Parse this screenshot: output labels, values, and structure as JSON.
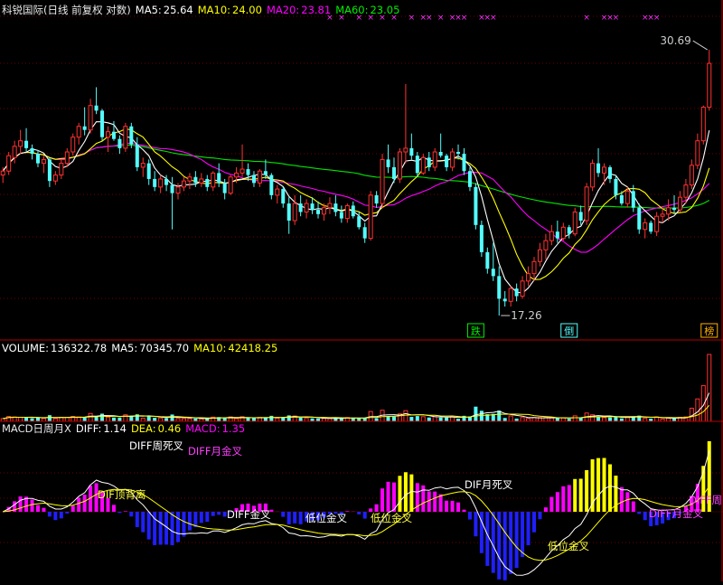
{
  "colors": {
    "up": "#ff3232",
    "down": "#54fcfc",
    "ma5": "#ffffff",
    "ma10": "#ffff00",
    "ma20": "#ff00ff",
    "ma60": "#00e600",
    "grid": "#6e0000",
    "panel_border": "#b40000",
    "macd_pos_top": "#ffff00",
    "macd_pos_mid": "#ff00ff",
    "macd_neg": "#2020ff"
  },
  "price_panel": {
    "title": "科锐国际(日线 前复权 对数)",
    "ma5": {
      "label": "MA5:",
      "value": "25.64"
    },
    "ma10": {
      "label": "MA10:",
      "value": "24.00"
    },
    "ma20": {
      "label": "MA20:",
      "value": "23.81"
    },
    "ma60": {
      "label": "MA60:",
      "value": "23.05"
    },
    "high_marker": "30.69",
    "low_marker": "17.26",
    "tags": [
      "跌",
      "倒",
      "榜"
    ]
  },
  "volume_panel": {
    "title": "VOLUME:",
    "volume": "136322.78",
    "ma5_label": "MA5:",
    "ma5": "70345.70",
    "ma10_label": "MA10:",
    "ma10": "42418.25"
  },
  "macd_panel": {
    "title": "MACD日周月X",
    "diff_label": "DIFF:",
    "diff": "1.14",
    "dea_label": "DEA:",
    "dea": "0.46",
    "macd_label": "MACD:",
    "macd": "1.35",
    "annotations": [
      {
        "text": "DIFF周死叉",
        "color": "#ffffff"
      },
      {
        "text": "DIFF月金叉",
        "color": "#ff40ff"
      },
      {
        "text": "DIF顶背离",
        "color": "#ffff40"
      },
      {
        "text": "DIFF金叉",
        "color": "#ffffff"
      },
      {
        "text": "低位金叉",
        "color": "#ffffff"
      },
      {
        "text": "低位金叉",
        "color": "#ffff40"
      },
      {
        "text": "DIF月死叉",
        "color": "#ffffff"
      },
      {
        "text": "低位金叉",
        "color": "#ffff40"
      },
      {
        "text": "DIFF月金叉",
        "color": "#ff40ff"
      },
      {
        "text": "DIFF周",
        "color": "#ff40ff"
      }
    ]
  },
  "chart_data": [
    {
      "type": "candlestick",
      "title": "科锐国际(日线 前复权 对数)",
      "yscale": "log",
      "ylim": [
        16.5,
        33
      ],
      "candles": [
        [
          23.4,
          23.8,
          23.0,
          23.6
        ],
        [
          23.6,
          24.6,
          23.4,
          24.4
        ],
        [
          24.3,
          25.2,
          24.0,
          24.9
        ],
        [
          24.9,
          25.8,
          24.5,
          25.2
        ],
        [
          25.2,
          25.9,
          24.6,
          24.8
        ],
        [
          24.8,
          25.0,
          24.2,
          24.5
        ],
        [
          24.5,
          24.7,
          23.8,
          24.0
        ],
        [
          24.0,
          24.4,
          23.5,
          24.2
        ],
        [
          24.2,
          24.3,
          22.8,
          23.1
        ],
        [
          23.1,
          23.6,
          22.9,
          23.4
        ],
        [
          23.4,
          24.2,
          23.2,
          24.0
        ],
        [
          24.0,
          24.8,
          23.8,
          24.6
        ],
        [
          24.6,
          25.6,
          24.4,
          25.4
        ],
        [
          25.4,
          26.2,
          25.0,
          26.0
        ],
        [
          26.0,
          27.1,
          25.5,
          25.8
        ],
        [
          25.8,
          27.6,
          25.6,
          27.2
        ],
        [
          27.2,
          28.3,
          26.7,
          26.9
        ],
        [
          26.9,
          27.0,
          25.2,
          25.4
        ],
        [
          25.4,
          26.0,
          24.6,
          25.7
        ],
        [
          25.7,
          26.3,
          25.2,
          25.3
        ],
        [
          25.3,
          25.5,
          24.5,
          24.8
        ],
        [
          24.8,
          26.2,
          24.6,
          26.0
        ],
        [
          26.0,
          26.2,
          24.8,
          25.0
        ],
        [
          25.0,
          25.4,
          23.6,
          23.8
        ],
        [
          23.8,
          24.3,
          23.3,
          24.0
        ],
        [
          24.0,
          24.2,
          22.9,
          23.2
        ],
        [
          23.2,
          23.6,
          22.6,
          22.8
        ],
        [
          22.8,
          23.4,
          22.5,
          23.2
        ],
        [
          23.2,
          23.4,
          22.6,
          22.9
        ],
        [
          22.9,
          23.3,
          20.8,
          22.5
        ],
        [
          22.5,
          23.0,
          22.2,
          22.8
        ],
        [
          22.8,
          23.3,
          22.6,
          23.1
        ],
        [
          23.1,
          23.5,
          22.7,
          23.3
        ],
        [
          23.3,
          23.6,
          22.8,
          23.0
        ],
        [
          23.0,
          23.5,
          22.8,
          23.2
        ],
        [
          23.2,
          23.4,
          22.6,
          22.8
        ],
        [
          22.8,
          23.6,
          22.6,
          23.5
        ],
        [
          23.5,
          24.0,
          22.8,
          23.0
        ],
        [
          23.0,
          23.2,
          22.2,
          22.5
        ],
        [
          22.5,
          23.4,
          22.4,
          23.3
        ],
        [
          23.3,
          23.8,
          23.0,
          23.5
        ],
        [
          23.5,
          25.0,
          23.3,
          23.7
        ],
        [
          23.7,
          24.0,
          23.1,
          23.4
        ],
        [
          23.4,
          23.6,
          22.8,
          23.0
        ],
        [
          23.0,
          23.7,
          22.8,
          23.6
        ],
        [
          23.6,
          24.2,
          23.2,
          23.4
        ],
        [
          23.4,
          23.5,
          22.2,
          22.4
        ],
        [
          22.4,
          22.9,
          22.0,
          22.7
        ],
        [
          22.7,
          22.8,
          21.8,
          22.0
        ],
        [
          22.0,
          22.3,
          20.6,
          21.2
        ],
        [
          21.2,
          22.4,
          21.0,
          22.0
        ],
        [
          22.0,
          22.4,
          21.4,
          21.6
        ],
        [
          21.6,
          22.2,
          21.3,
          22.0
        ],
        [
          22.0,
          22.3,
          21.5,
          21.7
        ],
        [
          21.7,
          22.1,
          21.3,
          21.5
        ],
        [
          21.5,
          22.0,
          21.2,
          21.8
        ],
        [
          21.8,
          22.3,
          21.5,
          22.0
        ],
        [
          22.0,
          22.4,
          21.4,
          21.6
        ],
        [
          21.6,
          21.9,
          21.1,
          21.3
        ],
        [
          21.3,
          22.0,
          21.1,
          21.9
        ],
        [
          21.9,
          22.1,
          21.3,
          21.4
        ],
        [
          21.4,
          21.6,
          20.8,
          20.9
        ],
        [
          20.9,
          21.1,
          20.2,
          20.4
        ],
        [
          20.4,
          22.6,
          20.3,
          22.4
        ],
        [
          22.4,
          22.6,
          21.8,
          22.0
        ],
        [
          22.0,
          24.5,
          21.8,
          24.2
        ],
        [
          24.2,
          25.0,
          23.5,
          23.8
        ],
        [
          23.8,
          24.3,
          23.0,
          23.2
        ],
        [
          23.2,
          24.8,
          23.0,
          24.6
        ],
        [
          24.6,
          28.5,
          24.0,
          24.8
        ],
        [
          24.8,
          25.6,
          24.2,
          24.4
        ],
        [
          24.4,
          24.6,
          23.3,
          23.5
        ],
        [
          23.5,
          24.5,
          23.4,
          24.3
        ],
        [
          24.3,
          24.6,
          23.6,
          23.8
        ],
        [
          23.8,
          24.8,
          23.6,
          24.6
        ],
        [
          24.6,
          25.6,
          24.3,
          24.4
        ],
        [
          24.4,
          24.5,
          23.6,
          23.8
        ],
        [
          23.8,
          24.8,
          23.6,
          24.6
        ],
        [
          24.6,
          25.0,
          24.2,
          24.5
        ],
        [
          24.5,
          24.8,
          23.4,
          23.6
        ],
        [
          23.6,
          23.8,
          22.6,
          22.8
        ],
        [
          22.8,
          23.0,
          20.8,
          21.0
        ],
        [
          21.0,
          21.2,
          19.6,
          19.8
        ],
        [
          19.8,
          20.0,
          18.9,
          19.1
        ],
        [
          19.1,
          20.2,
          18.6,
          18.8
        ],
        [
          18.8,
          19.2,
          17.26,
          17.9
        ],
        [
          17.9,
          18.2,
          17.6,
          17.8
        ],
        [
          17.8,
          18.4,
          17.6,
          18.3
        ],
        [
          18.3,
          18.5,
          17.8,
          18.0
        ],
        [
          18.0,
          18.8,
          17.9,
          18.6
        ],
        [
          18.6,
          19.2,
          18.4,
          18.9
        ],
        [
          18.9,
          19.6,
          18.6,
          19.4
        ],
        [
          19.4,
          20.2,
          19.2,
          19.9
        ],
        [
          19.9,
          20.6,
          19.5,
          20.3
        ],
        [
          20.3,
          21.0,
          20.1,
          20.7
        ],
        [
          20.7,
          21.2,
          20.2,
          20.4
        ],
        [
          20.4,
          21.1,
          20.3,
          20.9
        ],
        [
          20.9,
          21.0,
          20.4,
          20.6
        ],
        [
          20.6,
          21.8,
          20.5,
          21.6
        ],
        [
          21.6,
          21.9,
          21.0,
          21.2
        ],
        [
          21.2,
          23.0,
          21.0,
          22.8
        ],
        [
          22.8,
          24.2,
          22.6,
          24.0
        ],
        [
          24.0,
          24.8,
          23.3,
          23.5
        ],
        [
          23.5,
          24.0,
          22.9,
          23.8
        ],
        [
          23.8,
          23.9,
          23.0,
          23.2
        ],
        [
          23.2,
          23.4,
          22.2,
          22.4
        ],
        [
          22.4,
          22.6,
          21.9,
          22.0
        ],
        [
          22.0,
          22.8,
          21.8,
          22.6
        ],
        [
          22.6,
          22.9,
          21.6,
          21.8
        ],
        [
          21.8,
          22.0,
          20.6,
          20.8
        ],
        [
          20.8,
          21.3,
          20.4,
          21.1
        ],
        [
          21.1,
          21.2,
          20.6,
          20.7
        ],
        [
          20.7,
          21.6,
          20.5,
          21.4
        ],
        [
          21.4,
          21.8,
          21.1,
          21.5
        ],
        [
          21.5,
          22.2,
          21.2,
          21.8
        ],
        [
          21.8,
          22.4,
          21.5,
          21.7
        ],
        [
          21.7,
          22.6,
          21.6,
          22.3
        ],
        [
          22.3,
          23.2,
          22.0,
          22.9
        ],
        [
          22.9,
          24.2,
          22.7,
          23.9
        ],
        [
          23.9,
          25.6,
          23.7,
          25.2
        ],
        [
          25.2,
          27.2,
          25.0,
          27.1
        ],
        [
          27.1,
          30.69,
          26.9,
          29.8
        ]
      ]
    },
    {
      "type": "bar",
      "title": "VOLUME",
      "ma_labels": [
        "MA5",
        "MA10"
      ]
    },
    {
      "type": "bar",
      "title": "MACD日周月X",
      "series": [
        {
          "name": "DIFF",
          "values": [
            1.14
          ]
        },
        {
          "name": "DEA",
          "values": [
            0.46
          ]
        },
        {
          "name": "MACD",
          "values": [
            1.35
          ]
        }
      ]
    }
  ]
}
